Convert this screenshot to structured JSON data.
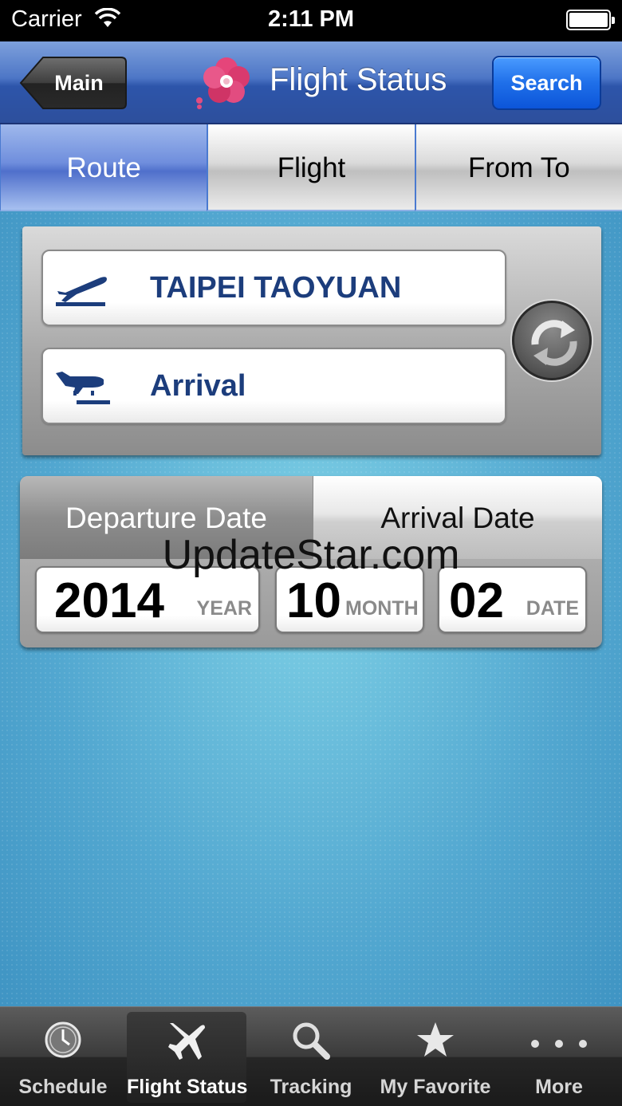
{
  "status_bar": {
    "carrier": "Carrier",
    "time": "2:11 PM",
    "battery_level": 1.0
  },
  "nav": {
    "back_label": "Main",
    "title": "Flight Status",
    "search_label": "Search",
    "logo_icon": "plum-blossom-icon"
  },
  "tabs": [
    {
      "label": "Route",
      "active": true
    },
    {
      "label": "Flight",
      "active": false
    },
    {
      "label": "From To",
      "active": false
    }
  ],
  "route": {
    "airport": {
      "value": "TAIPEI TAOYUAN",
      "icon": "departure-plane-icon"
    },
    "direction": {
      "value": "Arrival",
      "icon": "arrival-plane-icon"
    },
    "swap_icon": "refresh-icon"
  },
  "date": {
    "tabs": [
      {
        "label": "Departure Date",
        "active": true
      },
      {
        "label": "Arrival Date",
        "active": false
      }
    ],
    "year": {
      "value": "2014",
      "unit": "YEAR"
    },
    "month": {
      "value": "10",
      "unit": "MONTH"
    },
    "day": {
      "value": "02",
      "unit": "DATE"
    }
  },
  "watermark": "UpdateStar.com",
  "tab_bar": [
    {
      "label": "Schedule",
      "icon": "clock-icon",
      "selected": false
    },
    {
      "label": "Flight Status",
      "icon": "airplane-icon",
      "selected": true
    },
    {
      "label": "Tracking",
      "icon": "search-icon",
      "selected": false
    },
    {
      "label": "My Favorite",
      "icon": "star-icon",
      "selected": false
    },
    {
      "label": "More",
      "icon": "more-icon",
      "selected": false
    }
  ],
  "colors": {
    "nav_blue": "#2d55aa",
    "search_blue": "#1f6fe9",
    "field_text": "#1c3d7c",
    "background_teal": "#52a7d0"
  }
}
